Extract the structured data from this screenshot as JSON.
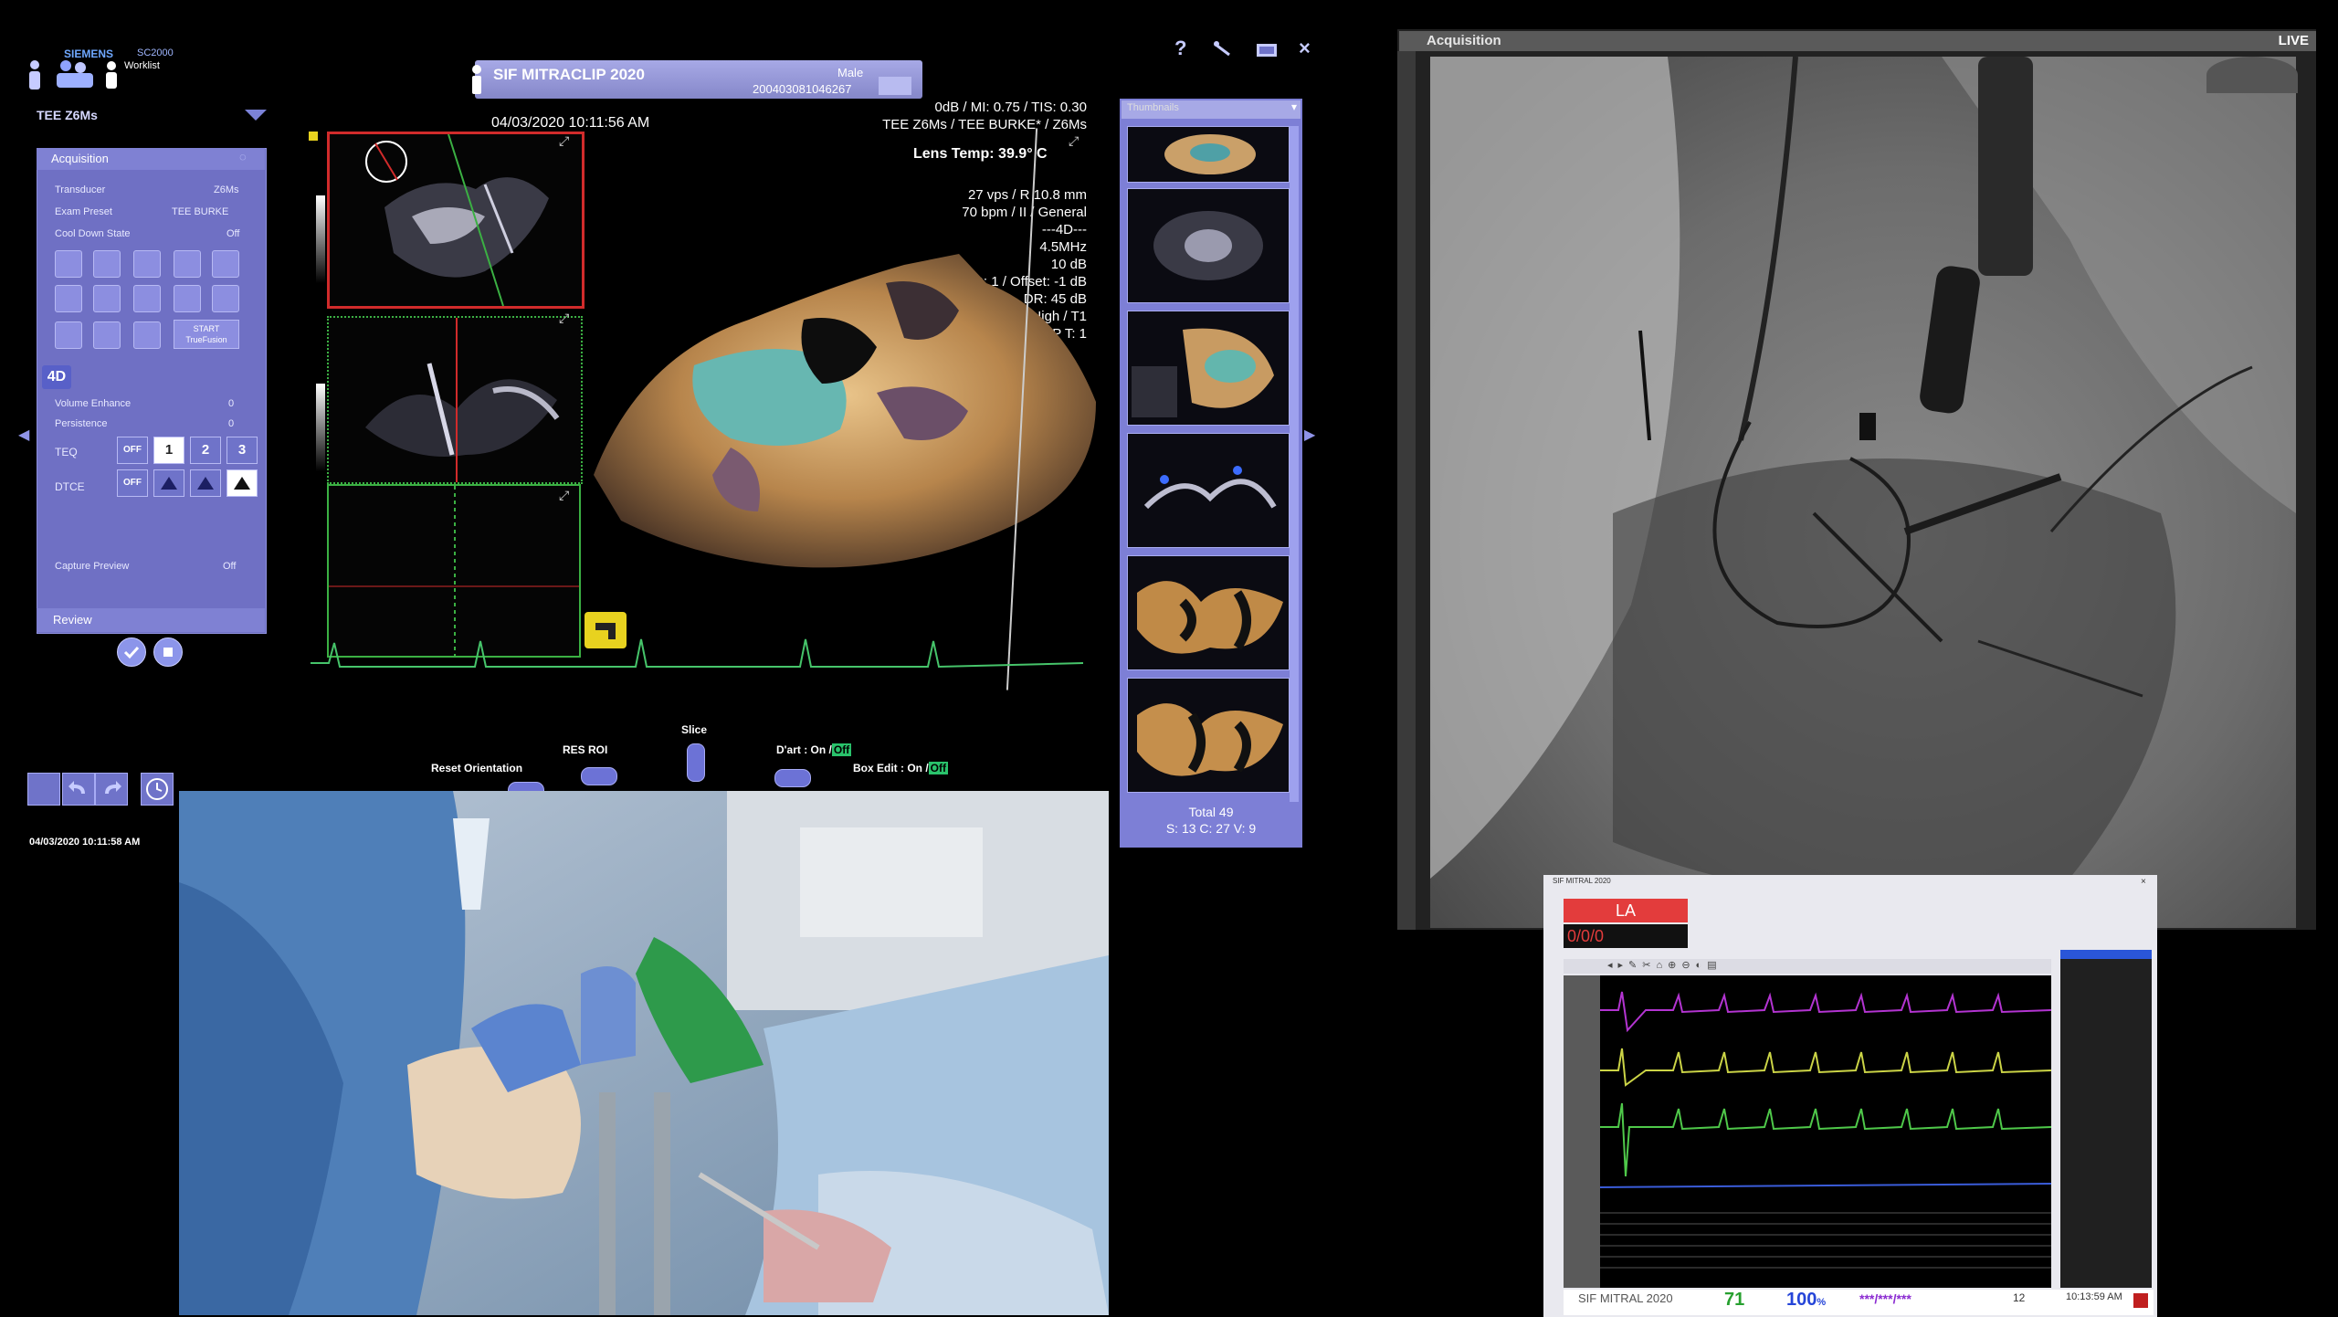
{
  "ultrasound": {
    "brand": "SIEMENS",
    "model": "SC2000",
    "worklist_label": "Worklist",
    "patient_name": "SIF MITRACLIP 2020",
    "patient_sex": "Male",
    "patient_id": "200403081046267",
    "preset_title": "TEE Z6Ms",
    "acquisition": {
      "header": "Acquisition",
      "rows": [
        {
          "label": "Transducer",
          "value": "Z6Ms"
        },
        {
          "label": "Exam Preset",
          "value": "TEE BURKE"
        },
        {
          "label": "Cool Down State",
          "value": "Off"
        }
      ],
      "start_label": "START TrueFusion",
      "mode_4d": "4D",
      "volume_enhance_label": "Volume Enhance",
      "volume_enhance_value": "0",
      "persistence_label": "Persistence",
      "persistence_value": "0",
      "teq_label": "TEQ",
      "teq_options": [
        "OFF",
        "1",
        "2",
        "3"
      ],
      "dtce_label": "DTCE",
      "dtce_options": [
        "OFF"
      ],
      "capture_preview_label": "Capture Preview",
      "capture_preview_value": "Off",
      "review_label": "Review"
    },
    "timestamp_top": "04/03/2020 10:11:56 AM",
    "params_line1": "0dB / MI: 0.75 / TIS: 0.30",
    "params_line2": "TEE Z6Ms / TEE BURKE* / Z6Ms",
    "lens_temp": "Lens Temp: 39.9° C",
    "scan_params": [
      "27 vps / R 10.8 mm",
      "70 bpm / II / General",
      "---4D---",
      "4.5MHz",
      "10 dB",
      "TEQ: 1 / Offset: -1 dB",
      "DR: 45 dB",
      "High / T1",
      "RP T: 1"
    ],
    "thumbnails_header": "Thumbnails",
    "thumb_total": "Total    49",
    "thumb_breakdown": "S: 13 C: 27 V: 9",
    "bottom_controls": {
      "reset_orientation": "Reset Orientation",
      "res_roi": "RES ROI",
      "slice": "Slice",
      "dart": "D'art : On /",
      "dart_state": "Off",
      "box_edit": "Box Edit : On /",
      "box_edit_state": "Off"
    },
    "timestamp_bottom": "04/03/2020 10:11:58 AM"
  },
  "fluoroscopy": {
    "title": "Acquisition",
    "status": "LIVE"
  },
  "hemodynamics": {
    "window_title": "SIF MITRAL 2020",
    "channel_label": "LA",
    "pressure_value": "0/0/0",
    "patient_name": "SIF MITRAL 2020",
    "hr": "71",
    "spo2": "100",
    "spo2_unit": "%",
    "nibp": "***/***/***",
    "count": "12",
    "time": "10:13:59 AM"
  },
  "colors": {
    "ui_purple": "#7f81d3",
    "red_frame": "#d12b2b",
    "green_frame": "#3bb043",
    "la_red": "#e33c3c"
  }
}
